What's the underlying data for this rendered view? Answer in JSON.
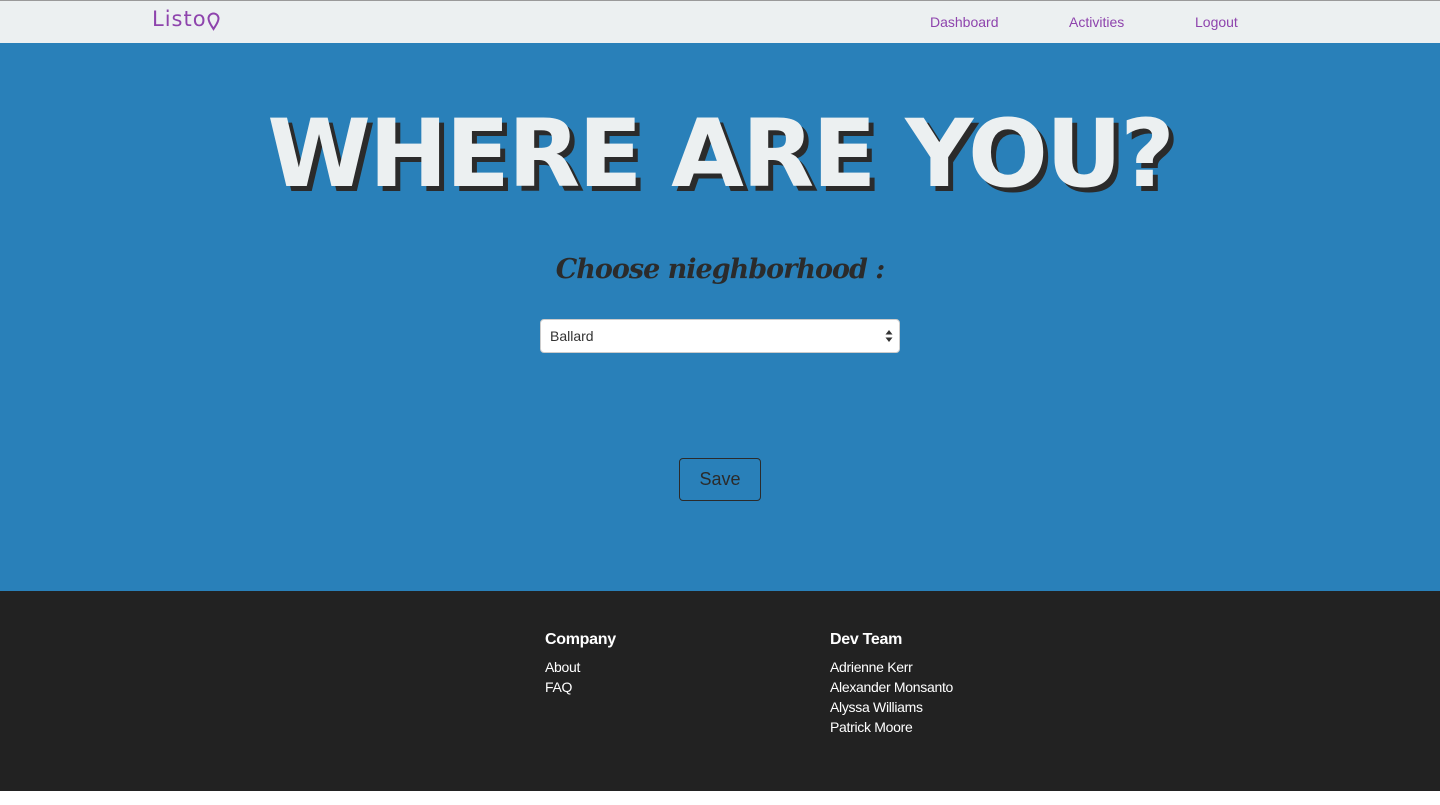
{
  "navbar": {
    "brand": "Listo",
    "brand_icon": "map-pin-icon",
    "links": [
      {
        "label": "Dashboard"
      },
      {
        "label": "Activities"
      },
      {
        "label": "Logout"
      }
    ],
    "link_color": "#8e44ad",
    "background": "#ecf0f1"
  },
  "hero": {
    "title": "WHERE ARE YOU?",
    "prompt": "Choose nieghborhood :",
    "neighborhood_select": {
      "selected": "Ballard"
    },
    "save_label": "Save",
    "background": "#2980b9"
  },
  "footer": {
    "company": {
      "heading": "Company",
      "links": [
        "About",
        "FAQ"
      ]
    },
    "dev_team": {
      "heading": "Dev Team",
      "members": [
        "Adrienne Kerr",
        "Alexander Monsanto",
        "Alyssa Williams",
        "Patrick Moore"
      ]
    },
    "background": "#222222"
  }
}
